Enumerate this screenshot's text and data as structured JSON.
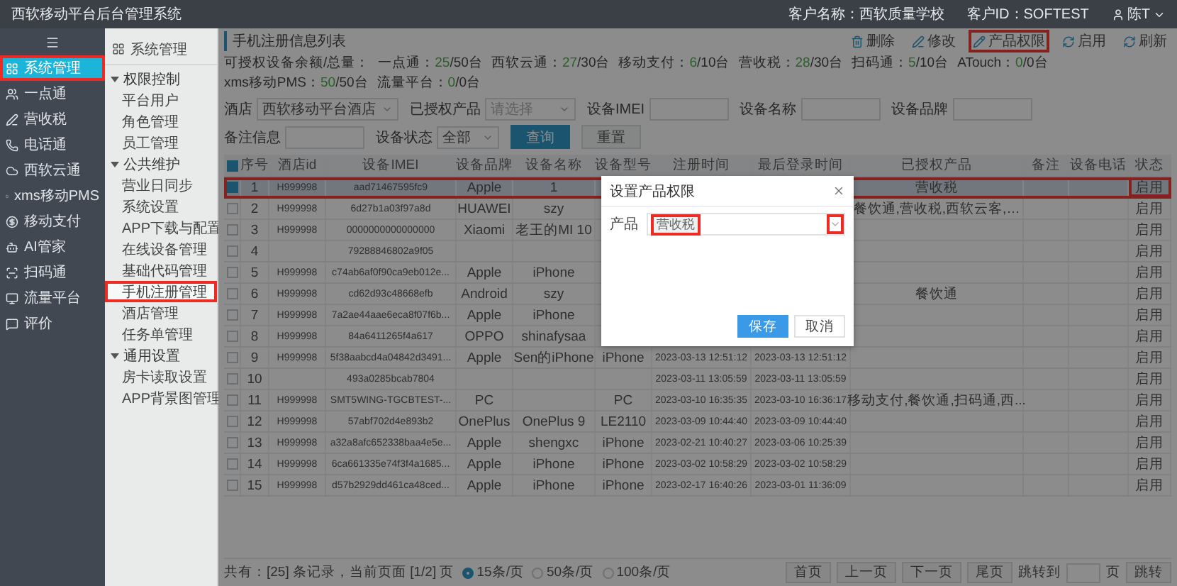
{
  "header": {
    "title": "西软移动平台后台管理系统",
    "customer_name": "客户名称：西软质量学校",
    "customer_id": "客户ID：SOFTEST",
    "user": "陈T"
  },
  "nav": {
    "items": [
      {
        "label": "系统管理",
        "selected": true,
        "highlighted": true
      },
      {
        "label": "一点通",
        "selected": false,
        "highlighted": false
      },
      {
        "label": "营收税",
        "selected": false,
        "highlighted": false
      },
      {
        "label": "电话通",
        "selected": false,
        "highlighted": false
      },
      {
        "label": "西软云通",
        "selected": false,
        "highlighted": false
      },
      {
        "label": "xms移动PMS",
        "selected": false,
        "highlighted": false
      },
      {
        "label": "移动支付",
        "selected": false,
        "highlighted": false
      },
      {
        "label": "AI管家",
        "selected": false,
        "highlighted": false
      },
      {
        "label": "扫码通",
        "selected": false,
        "highlighted": false
      },
      {
        "label": "流量平台",
        "selected": false,
        "highlighted": false
      },
      {
        "label": "评价",
        "selected": false,
        "highlighted": false
      }
    ]
  },
  "subnav": {
    "title": "系统管理",
    "groups": [
      {
        "label": "权限控制",
        "expanded": true,
        "children": [
          {
            "label": "平台用户",
            "selected": false,
            "highlighted": false
          },
          {
            "label": "角色管理",
            "selected": false,
            "highlighted": false
          },
          {
            "label": "员工管理",
            "selected": false,
            "highlighted": false
          }
        ]
      },
      {
        "label": "公共维护",
        "expanded": true,
        "children": [
          {
            "label": "营业日同步",
            "selected": false,
            "highlighted": false
          },
          {
            "label": "系统设置",
            "selected": false,
            "highlighted": false
          },
          {
            "label": "APP下载与配置",
            "selected": false,
            "highlighted": false
          },
          {
            "label": "在线设备管理",
            "selected": false,
            "highlighted": false
          },
          {
            "label": "基础代码管理",
            "selected": false,
            "highlighted": false
          },
          {
            "label": "手机注册管理",
            "selected": true,
            "highlighted": true
          },
          {
            "label": "酒店管理",
            "selected": false,
            "highlighted": false
          },
          {
            "label": "任务单管理",
            "selected": false,
            "highlighted": false
          }
        ]
      },
      {
        "label": "通用设置",
        "expanded": true,
        "children": [
          {
            "label": "房卡读取设置",
            "selected": false,
            "highlighted": false
          },
          {
            "label": "APP背景图管理",
            "selected": false,
            "highlighted": false
          }
        ]
      }
    ]
  },
  "page": {
    "title": "手机注册信息列表",
    "actions": [
      {
        "label": "删除",
        "highlighted": false
      },
      {
        "label": "修改",
        "highlighted": false
      },
      {
        "label": "产品权限",
        "highlighted": true
      },
      {
        "label": "启用",
        "highlighted": false
      },
      {
        "label": "刷新",
        "highlighted": false
      }
    ],
    "quota": {
      "label": "可授权设备余额/总量：",
      "items": [
        {
          "name": "一点通：",
          "used": "25",
          "total": "/50台"
        },
        {
          "name": "西软云通：",
          "used": "27",
          "total": "/30台"
        },
        {
          "name": "移动支付：",
          "used": "6",
          "total": "/10台"
        },
        {
          "name": "营收税：",
          "used": "28",
          "total": "/30台"
        },
        {
          "name": "扫码通：",
          "used": "5",
          "total": "/10台"
        },
        {
          "name": "ATouch：",
          "used": "0",
          "total": "/0台"
        },
        {
          "name": "xms移动PMS：",
          "used": "50",
          "total": "/50台"
        },
        {
          "name": "流量平台：",
          "used": "0",
          "total": "/0台"
        }
      ]
    },
    "filters": [
      {
        "label": "酒店",
        "kind": "select",
        "value": "西软移动平台酒店"
      },
      {
        "label": "已授权产品",
        "kind": "select",
        "placeholder": "请选择"
      },
      {
        "label": "设备IMEI",
        "kind": "input"
      },
      {
        "label": "设备名称",
        "kind": "input"
      },
      {
        "label": "设备品牌",
        "kind": "input"
      },
      {
        "label": "备注信息",
        "kind": "input"
      },
      {
        "label": "设备状态",
        "kind": "select",
        "value": "全部"
      }
    ],
    "filter_buttons": [
      {
        "label": "查询",
        "kind": "primary"
      },
      {
        "label": "重置",
        "kind": "default"
      }
    ]
  },
  "table": {
    "select_all_checked": true,
    "columns": [
      "序号",
      "酒店id",
      "设备IMEI",
      "设备品牌",
      "设备名称",
      "设备型号",
      "注册时间",
      "最后登录时间",
      "已授权产品",
      "备注",
      "设备电话",
      "状态"
    ],
    "rows": [
      {
        "no": "1",
        "hotel_id": "H999998",
        "imei": "aad71467595fc9",
        "brand": "Apple",
        "name": "1",
        "products": "营收税",
        "status": "启用",
        "checked": true,
        "highlighted": true,
        "status_highlighted": true
      },
      {
        "no": "2",
        "hotel_id": "H999998",
        "imei": "6d27b1a03f97a8d",
        "brand": "HUAWEI",
        "name": "szy",
        "products": "餐饮通,营收税,西软云客,…",
        "status": "启用",
        "checked": false,
        "highlighted": false,
        "status_highlighted": false
      },
      {
        "no": "3",
        "hotel_id": "H999998",
        "imei": "0000000000000000",
        "brand": "Xiaomi",
        "name": "老王的MI 10",
        "status": "启用",
        "checked": false,
        "highlighted": false,
        "status_highlighted": false
      },
      {
        "no": "4",
        "imei": "79288846802a9f05",
        "status": "启用",
        "checked": false,
        "highlighted": false,
        "status_highlighted": false
      },
      {
        "no": "5",
        "hotel_id": "H999998",
        "imei": "c74ab6af0f90ca9eb012e...",
        "brand": "Apple",
        "name": "iPhone",
        "status": "启用",
        "checked": false,
        "highlighted": false,
        "status_highlighted": false
      },
      {
        "no": "6",
        "hotel_id": "H999998",
        "imei": "cd62d93c48668efb",
        "brand": "Android",
        "name": "szy",
        "products": "餐饮通",
        "status": "启用",
        "checked": false,
        "highlighted": false,
        "status_highlighted": false
      },
      {
        "no": "7",
        "hotel_id": "H999998",
        "imei": "7a2ae44aae6eca8f07f6b...",
        "brand": "Apple",
        "name": "iPhone",
        "status": "启用",
        "checked": false,
        "highlighted": false,
        "status_highlighted": false
      },
      {
        "no": "8",
        "hotel_id": "H999998",
        "imei": "84a6411265f4a617",
        "brand": "OPPO",
        "name": "shinafysaa",
        "status": "启用",
        "checked": false,
        "highlighted": false,
        "status_highlighted": false
      },
      {
        "no": "9",
        "hotel_id": "H999998",
        "imei": "5f38aabcd4a04842d3491...",
        "brand": "Apple",
        "name": "Sen的iPhone",
        "model": "iPhone",
        "registered": "2023-03-13 12:51:12",
        "last_login": "2023-03-13 12:51:12",
        "status": "启用",
        "checked": false,
        "highlighted": false,
        "status_highlighted": false
      },
      {
        "no": "10",
        "imei": "493a0285bcab7804",
        "registered": "2023-03-11 13:05:59",
        "last_login": "2023-03-11 13:05:59",
        "status": "启用",
        "checked": false,
        "highlighted": false,
        "status_highlighted": false
      },
      {
        "no": "11",
        "hotel_id": "H999998",
        "imei": "SMT5WING-TGCBTEST-...",
        "brand": "PC",
        "model": "PC",
        "registered": "2023-03-10 16:35:35",
        "last_login": "2023-03-10 16:36:17",
        "products": "移动支付,餐饮通,扫码通,西...",
        "status": "启用",
        "checked": false,
        "highlighted": false,
        "status_highlighted": false
      },
      {
        "no": "12",
        "hotel_id": "H999998",
        "imei": "57abf702d4e893b2",
        "brand": "OnePlus",
        "name": "OnePlus 9",
        "model": "LE2110",
        "registered": "2023-03-09 10:44:40",
        "last_login": "2023-03-09 10:44:40",
        "status": "启用",
        "checked": false,
        "highlighted": false,
        "status_highlighted": false
      },
      {
        "no": "13",
        "hotel_id": "H999998",
        "imei": "a32a8afc652338baa4e5e...",
        "brand": "Apple",
        "name": "shengxc",
        "model": "iPhone",
        "registered": "2023-02-21 10:40:27",
        "last_login": "2023-03-06 10:25:39",
        "status": "启用",
        "checked": false,
        "highlighted": false,
        "status_highlighted": false
      },
      {
        "no": "14",
        "hotel_id": "H999998",
        "imei": "6ca661335e74f3f4a1685...",
        "brand": "Apple",
        "name": "iPhone",
        "model": "iPhone",
        "registered": "2023-03-02 10:58:29",
        "last_login": "2023-03-02 10:58:29",
        "status": "启用",
        "checked": false,
        "highlighted": false,
        "status_highlighted": false
      },
      {
        "no": "15",
        "hotel_id": "H999998",
        "imei": "d57b2929dd461ca48ced...",
        "brand": "Apple",
        "name": "iPhone",
        "model": "iPhone",
        "registered": "2023-02-17 16:40:26",
        "last_login": "2023-03-01 11:36:09",
        "status": "启用",
        "checked": false,
        "highlighted": false,
        "status_highlighted": false
      }
    ]
  },
  "pager": {
    "summary": "共有：[25] 条记录，当前页面 [1/2] 页",
    "page_sizes": [
      {
        "label": "15条/页",
        "selected": true
      },
      {
        "label": "50条/页",
        "selected": false
      },
      {
        "label": "100条/页",
        "selected": false
      }
    ],
    "nav_buttons": [
      "首页",
      "上一页",
      "下一页",
      "尾页"
    ],
    "jump_label": "跳转到",
    "jump_unit": "页",
    "jump_button": "跳转"
  },
  "modal": {
    "title": "设置产品权限",
    "field_label": "产品",
    "tags": [
      {
        "label": "营收税",
        "highlighted": true
      }
    ],
    "caret_highlighted": true,
    "buttons": [
      {
        "label": "保存",
        "kind": "primary"
      },
      {
        "label": "取消",
        "kind": "default"
      }
    ]
  }
}
